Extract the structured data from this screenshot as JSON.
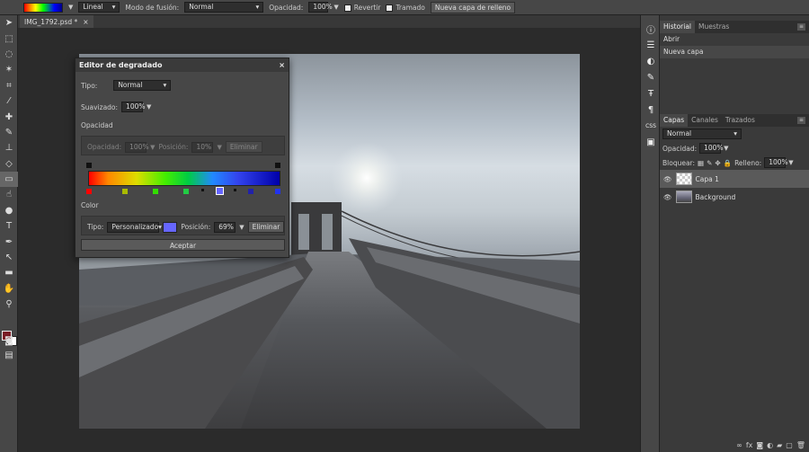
{
  "topbar": {
    "mode_value": "Lineal",
    "blend_label": "Modo de fusión:",
    "blend_value": "Normal",
    "opacity_label": "Opacidad:",
    "opacity_value": "100%",
    "reverse_label": "Revertir",
    "dither_label": "Tramado",
    "fill_layer_button": "Nueva capa de relleno"
  },
  "document": {
    "tab_title": "IMG_1792.psd *",
    "close": "×"
  },
  "tools": [
    "move-icon",
    "marquee-icon",
    "lasso-icon",
    "magic-wand-icon",
    "crop-icon",
    "eyedropper-icon",
    "healing-icon",
    "brush-icon",
    "stamp-icon",
    "eraser-icon",
    "gradient-icon",
    "smudge-icon",
    "dodge-icon",
    "type-icon",
    "pen-icon",
    "path-select-icon",
    "shape-icon",
    "hand-icon",
    "zoom-icon"
  ],
  "colors": {
    "foreground": "#7a1c25",
    "background": "#ffffff"
  },
  "history_panel": {
    "tabs": [
      "Historial",
      "Muestras"
    ],
    "items": [
      "Abrir",
      "Nueva capa"
    ]
  },
  "layers_panel": {
    "tabs": [
      "Capas",
      "Canales",
      "Trazados"
    ],
    "blend_value": "Normal",
    "opacity_label": "Opacidad:",
    "opacity_value": "100%",
    "lock_label": "Bloquear:",
    "fill_label": "Relleno:",
    "fill_value": "100%",
    "layers": [
      {
        "name": "Capa 1",
        "selected": true
      },
      {
        "name": "Background",
        "selected": false
      }
    ]
  },
  "gradient_editor": {
    "title": "Editor de degradado",
    "close": "×",
    "type_label": "Tipo:",
    "type_value": "Normal",
    "smooth_label": "Suavizado:",
    "smooth_value": "100%",
    "opacity_section": "Opacidad",
    "opacity_label": "Opacidad:",
    "opacity_value": "100%",
    "position_label": "Posición:",
    "opacity_position_value": "10%",
    "delete_label": "Eliminar",
    "color_section": "Color",
    "color_type_label": "Tipo:",
    "color_type_value": "Personalizado",
    "color_swatch": "#6666ff",
    "color_position_label": "Posición:",
    "color_position_value": "69%",
    "color_delete_label": "Eliminar",
    "accept_label": "Aceptar",
    "color_stops": [
      "#ff0000",
      "#aabb00",
      "#33dd00",
      "#22cc44",
      "#6666ff",
      "#2222aa",
      "#2233ee"
    ]
  }
}
